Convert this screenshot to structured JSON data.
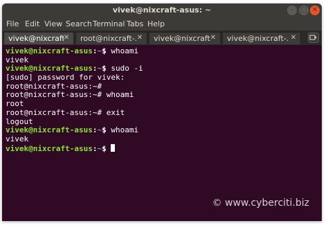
{
  "window": {
    "title": "vivek@nixcraft-asus: ~",
    "controls": {
      "minimize": "–",
      "maximize": "□",
      "close": "✕"
    }
  },
  "menu": [
    "File",
    "Edit",
    "View",
    "Search",
    "Terminal",
    "Tabs",
    "Help"
  ],
  "tabs": [
    {
      "label": "vivek@nixcraft-asu...",
      "active": true
    },
    {
      "label": "root@nixcraft-...",
      "active": false
    },
    {
      "label": "vivek@nixcraft-...",
      "active": false
    },
    {
      "label": "vivek@nixcraft-...",
      "active": false
    }
  ],
  "tab_close_glyph": "✕",
  "terminal": {
    "lines": [
      {
        "prompt": "vivek@nixcraft-asus",
        "sep": ":",
        "path": "~",
        "sym": "$ ",
        "cmd": "whoami"
      },
      {
        "text": "vivek"
      },
      {
        "prompt": "vivek@nixcraft-asus",
        "sep": ":",
        "path": "~",
        "sym": "$ ",
        "cmd": "sudo -i"
      },
      {
        "text": "[sudo] password for vivek:"
      },
      {
        "text": "root@nixcraft-asus:~# "
      },
      {
        "text": "root@nixcraft-asus:~# whoami"
      },
      {
        "text": "root"
      },
      {
        "text": "root@nixcraft-asus:~# exit"
      },
      {
        "text": "logout"
      },
      {
        "prompt": "vivek@nixcraft-asus",
        "sep": ":",
        "path": "~",
        "sym": "$ ",
        "cmd": "whoami"
      },
      {
        "text": "vivek"
      },
      {
        "prompt": "vivek@nixcraft-asus",
        "sep": ":",
        "path": "~",
        "sym": "$ ",
        "cmd": "",
        "cursor": true
      }
    ]
  },
  "watermark": "© www.cyberciti.biz",
  "colors": {
    "terminal_bg": "#300a24",
    "prompt_user": "#8ae234",
    "prompt_path": "#729fcf",
    "titlebar": "#3c3b37",
    "close_button": "#e9542a"
  }
}
